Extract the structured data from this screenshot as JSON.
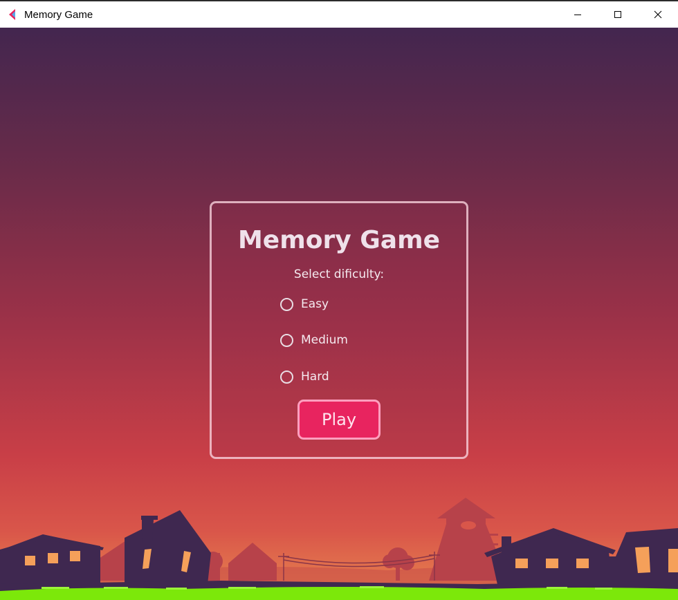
{
  "window": {
    "title": "Memory Game",
    "minimize_icon": "minimize-icon",
    "maximize_icon": "maximize-icon",
    "close_icon": "close-icon"
  },
  "menu": {
    "title": "Memory Game",
    "subtitle": "Select dificulty:",
    "options": [
      {
        "label": "Easy",
        "selected": false
      },
      {
        "label": "Medium",
        "selected": false
      },
      {
        "label": "Hard",
        "selected": false
      }
    ],
    "play_label": "Play"
  },
  "colors": {
    "accent": "#e8245f",
    "accent_border": "#ff9fbf",
    "silhouette": "#3f2850",
    "window_lights": "#f5a05a",
    "grass": "#7ce80a"
  }
}
